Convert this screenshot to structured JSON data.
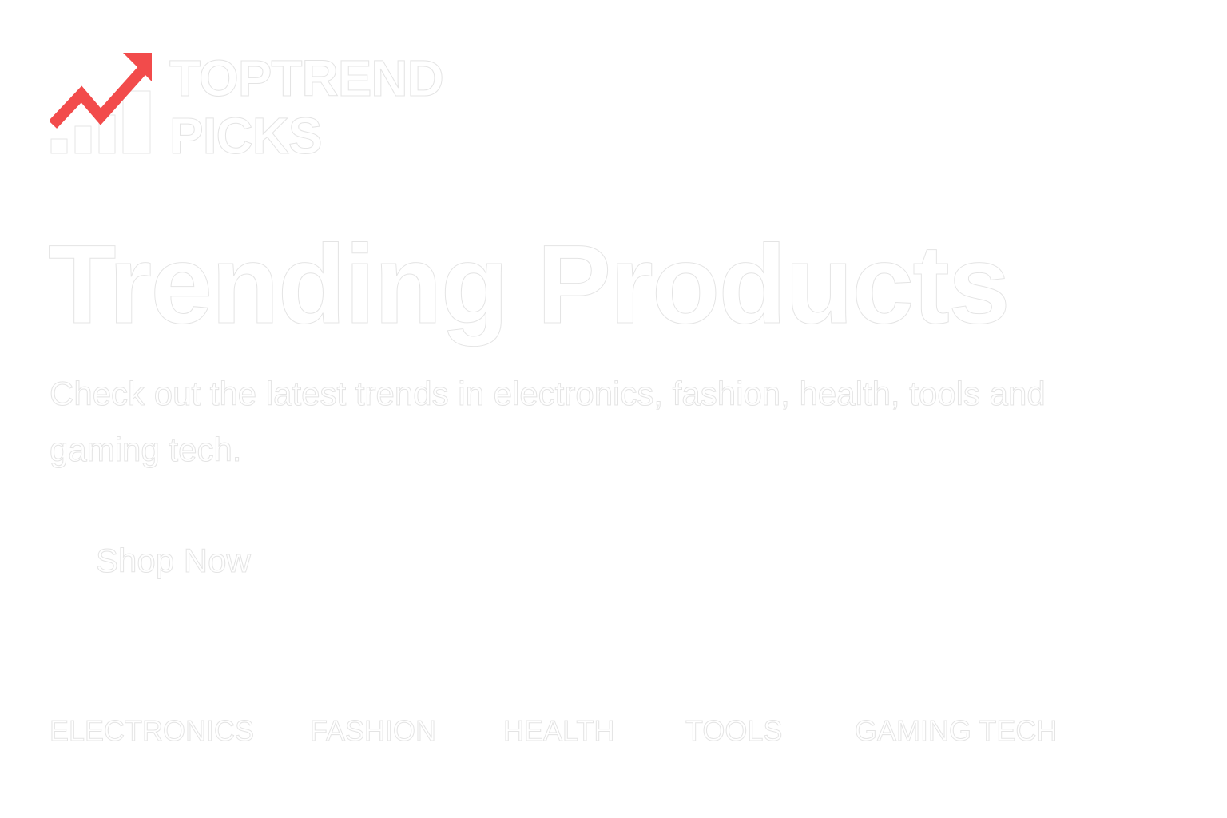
{
  "brand": {
    "line1": "TOPTREND",
    "line2": "PICKS",
    "logo_icon": "trend-arrow-bar-chart-icon",
    "accent_color": "#f24b4b"
  },
  "hero": {
    "title": "Trending Products",
    "subtitle": "Check out the latest trends in electronics, fashion, health, tools and gaming tech.",
    "cta_label": "Shop Now"
  },
  "categories": [
    {
      "label": "ELECTRONICS"
    },
    {
      "label": "FASHION"
    },
    {
      "label": "HEALTH"
    },
    {
      "label": "TOOLS"
    },
    {
      "label": "GAMING TECH"
    }
  ],
  "colors": {
    "background": "#ffffff",
    "text": "#ffffff",
    "text_outline": "#e4e4e4"
  }
}
